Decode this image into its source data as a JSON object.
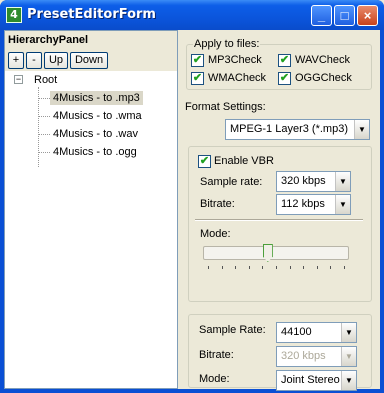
{
  "window": {
    "title": "PresetEditorForm",
    "icon_glyph": "4",
    "controls": {
      "minimize": "_",
      "maximize": "□",
      "close": "×"
    }
  },
  "hierarchy": {
    "header": "HierarchyPanel",
    "toolbar": {
      "add": "+",
      "remove": "-",
      "up": "Up",
      "down": "Down"
    },
    "tree": {
      "root_label": "Root",
      "expander": "−",
      "children": [
        {
          "label": "4Musics - to .mp3",
          "selected": true
        },
        {
          "label": "4Musics - to .wma",
          "selected": false
        },
        {
          "label": "4Musics - to .wav",
          "selected": false
        },
        {
          "label": "4Musics - to .ogg",
          "selected": false
        }
      ]
    }
  },
  "apply_to_files": {
    "title": "Apply to files:",
    "mp3": {
      "label": "MP3Check",
      "checked": true
    },
    "wav": {
      "label": "WAVCheck",
      "checked": true
    },
    "wma": {
      "label": "WMACheck",
      "checked": true
    },
    "ogg": {
      "label": "OGGCheck",
      "checked": true
    },
    "check_glyph": "✔"
  },
  "format_settings": {
    "label": "Format Settings:",
    "value": "MPEG-1 Layer3 (*.mp3)"
  },
  "vbr": {
    "enable_label": "Enable VBR",
    "enabled": true,
    "sample_rate_label": "Sample rate:",
    "sample_rate_value": "320 kbps",
    "bitrate_label": "Bitrate:",
    "bitrate_value": "112 kbps",
    "mode_label": "Mode:",
    "mode_slider_position": 0.44
  },
  "output": {
    "sample_rate_label": "Sample Rate:",
    "sample_rate_value": "44100",
    "bitrate_label": "Bitrate:",
    "bitrate_value": "320 kbps",
    "mode_label": "Mode:",
    "mode_value": "Joint Stereo"
  },
  "dropdown_arrow": "▼"
}
